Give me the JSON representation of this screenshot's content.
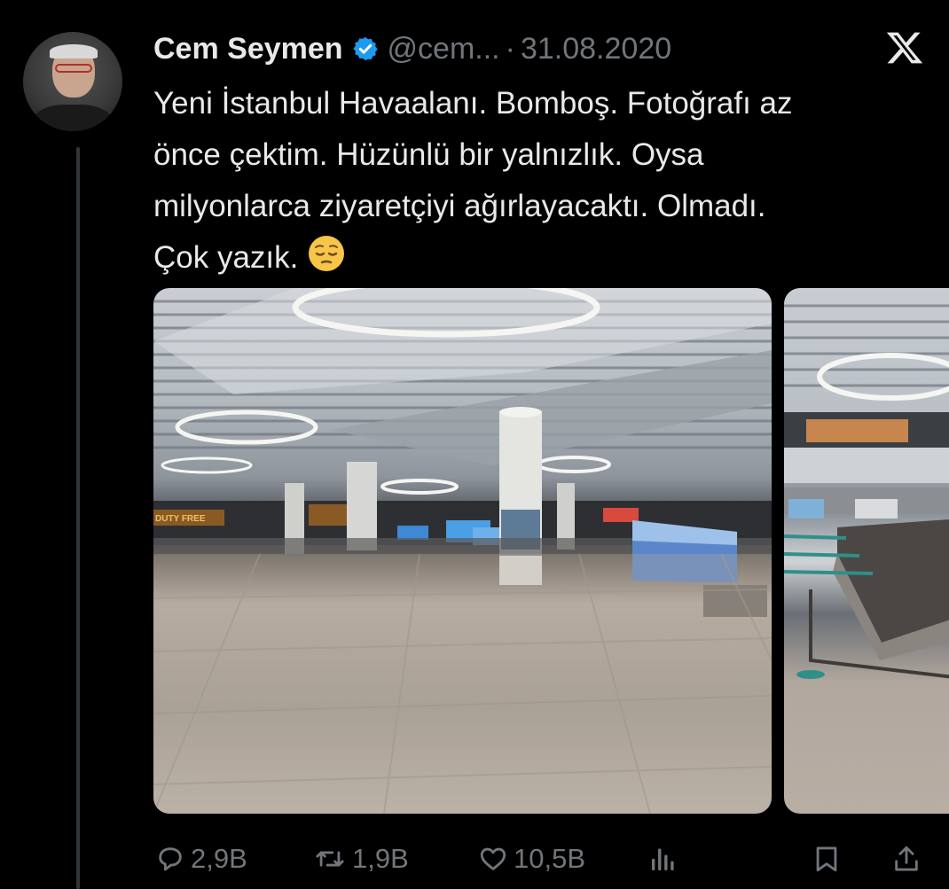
{
  "author": {
    "name": "Cem Seymen",
    "handle": "@cem...",
    "separator": "·",
    "date": "31.08.2020",
    "verified": true,
    "avatar_icon": "profile-photo"
  },
  "platform_logo": "x-logo",
  "tweet": {
    "lines": [
      "Yeni İstanbul Havaalanı. Bomboş. Fotoğrafı az",
      "önce çektim. Hüzünlü bir yalnızlık. Oysa",
      "milyonlarca ziyaretçiyi ağırlayacaktı. Olmadı.",
      "Çok yazık."
    ],
    "emoji": "pensive-face-emoji"
  },
  "media": [
    {
      "kind": "photo",
      "subject": "empty airport arrivals hall",
      "sign_text": "DUTY FREE"
    },
    {
      "kind": "photo",
      "subject": "empty baggage carousel"
    }
  ],
  "actions": {
    "reply": {
      "icon": "reply-icon",
      "count": "2,9B"
    },
    "retweet": {
      "icon": "retweet-icon",
      "count": "1,9B"
    },
    "like": {
      "icon": "heart-icon",
      "count": "10,5B"
    },
    "views": {
      "icon": "analytics-icon"
    },
    "bookmark": {
      "icon": "bookmark-icon"
    },
    "share": {
      "icon": "share-icon"
    }
  },
  "colors": {
    "background": "#000000",
    "text": "#e7e9ea",
    "muted": "#71767b",
    "verified": "#1d9bf0"
  }
}
